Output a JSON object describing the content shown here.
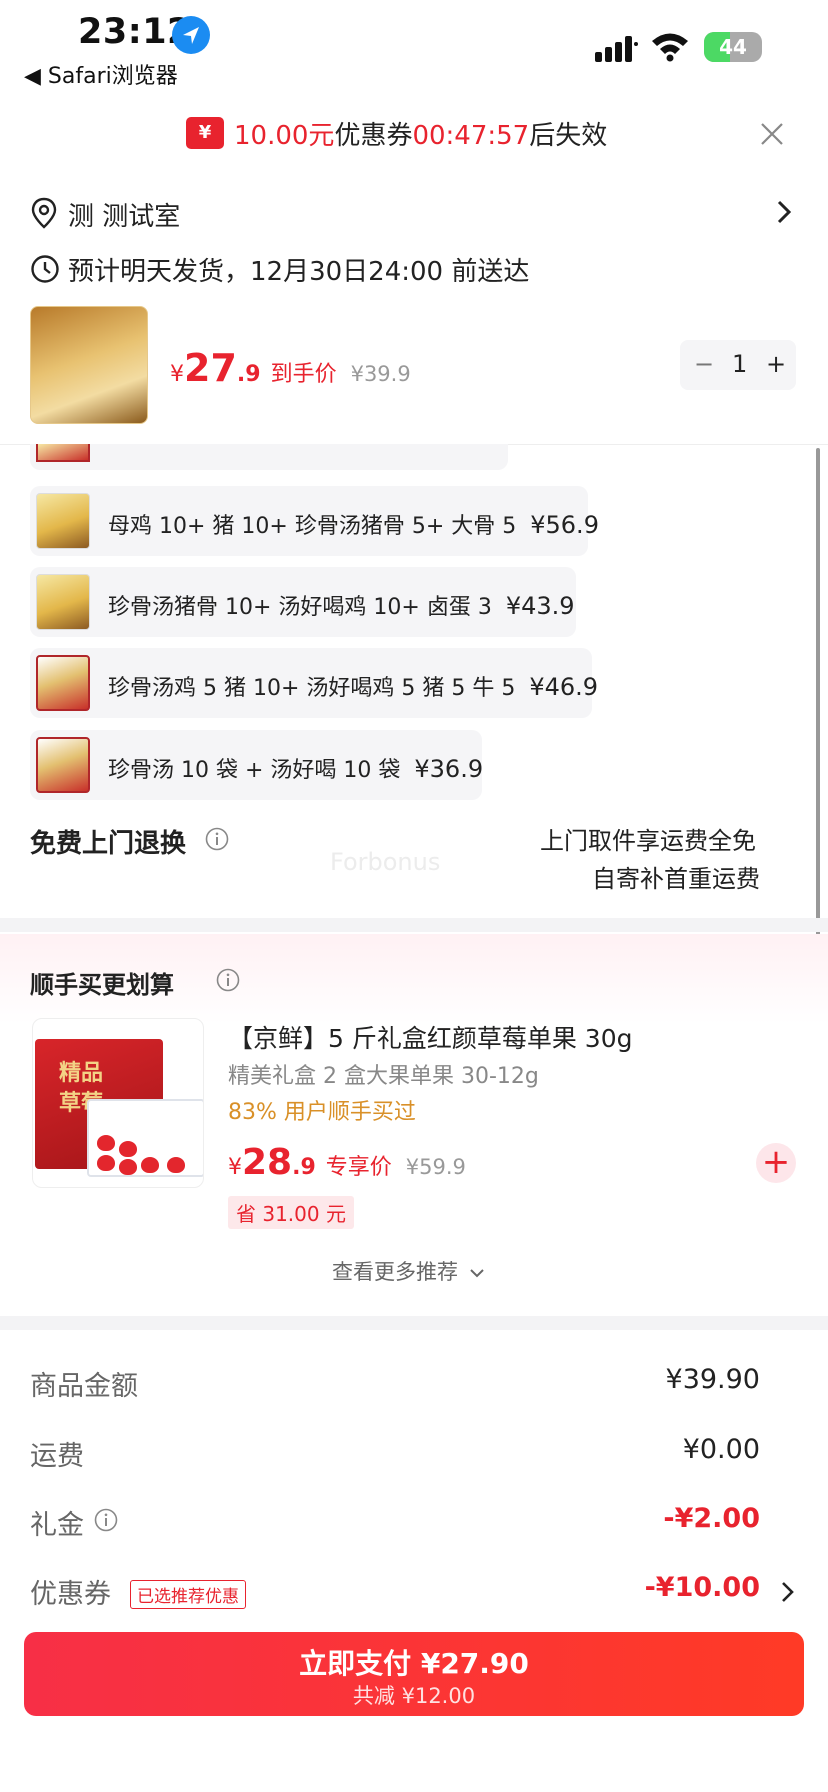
{
  "status_bar": {
    "time": "23:12",
    "back_app": "◀ Safari浏览器",
    "battery": "44"
  },
  "coupon_banner": {
    "amount": "10.00元",
    "text": "优惠券",
    "countdown": "00:47:57",
    "suffix": "后失效",
    "icon_glyph": "¥"
  },
  "address": {
    "text": "测 测试室"
  },
  "delivery": {
    "text": "预计明天发货，12月30日24:00 前送达"
  },
  "product": {
    "price_currency": "¥",
    "price_int": "27",
    "price_dec": ".9",
    "price_tag": "到手价",
    "original_price": "¥39.9",
    "quantity": "1",
    "minus": "−",
    "plus": "+"
  },
  "variants": [
    {
      "label": "母鸡 10+ 猪 10+ 珍骨汤猪骨 5+ 大骨 5",
      "price": "¥56.9"
    },
    {
      "label": "珍骨汤猪骨 10+ 汤好喝鸡 10+ 卤蛋 3",
      "price": "¥43.9"
    },
    {
      "label": "珍骨汤鸡 5 猪 10+ 汤好喝鸡 5 猪 5 牛 5",
      "price": "¥46.9"
    },
    {
      "label": "珍骨汤 10 袋 + 汤好喝 10 袋",
      "price": "¥36.9"
    }
  ],
  "free_return": {
    "title": "免费上门退换",
    "right_line1": "上门取件享运费全免",
    "right_line2": "自寄补首重运费",
    "watermark": "Forbonus"
  },
  "recommendation": {
    "section_title": "顺手买更划算",
    "image_text": "精品草莓",
    "name": "【京鲜】5 斤礼盒红颜草莓单果 30g",
    "subtitle": "精美礼盒 2 盒大果单果 30-12g",
    "percent": "83% 用户顺手买过",
    "price_currency": "¥",
    "price_int": "28",
    "price_dec": ".9",
    "price_tag": "专享价",
    "original_price": "¥59.9",
    "save": "省 31.00 元",
    "add": "+",
    "more": "查看更多推荐"
  },
  "summary": {
    "goods_label": "商品金额",
    "goods_value": "¥39.90",
    "shipping_label": "运费",
    "shipping_value": "¥0.00",
    "gift_label": "礼金",
    "gift_value": "-¥2.00",
    "coupon_label": "优惠券",
    "coupon_badge": "已选推荐优惠",
    "coupon_value": "-¥10.00"
  },
  "pay_button": {
    "label": "立即支付 ¥27.90",
    "sub": "共减 ¥12.00"
  },
  "colors": {
    "accent": "#e8232e",
    "pay_gradient_start": "#f72f46",
    "pay_gradient_end": "#ff3a26",
    "orange_text": "#d99028",
    "chip_bg": "#f5f5f7"
  }
}
